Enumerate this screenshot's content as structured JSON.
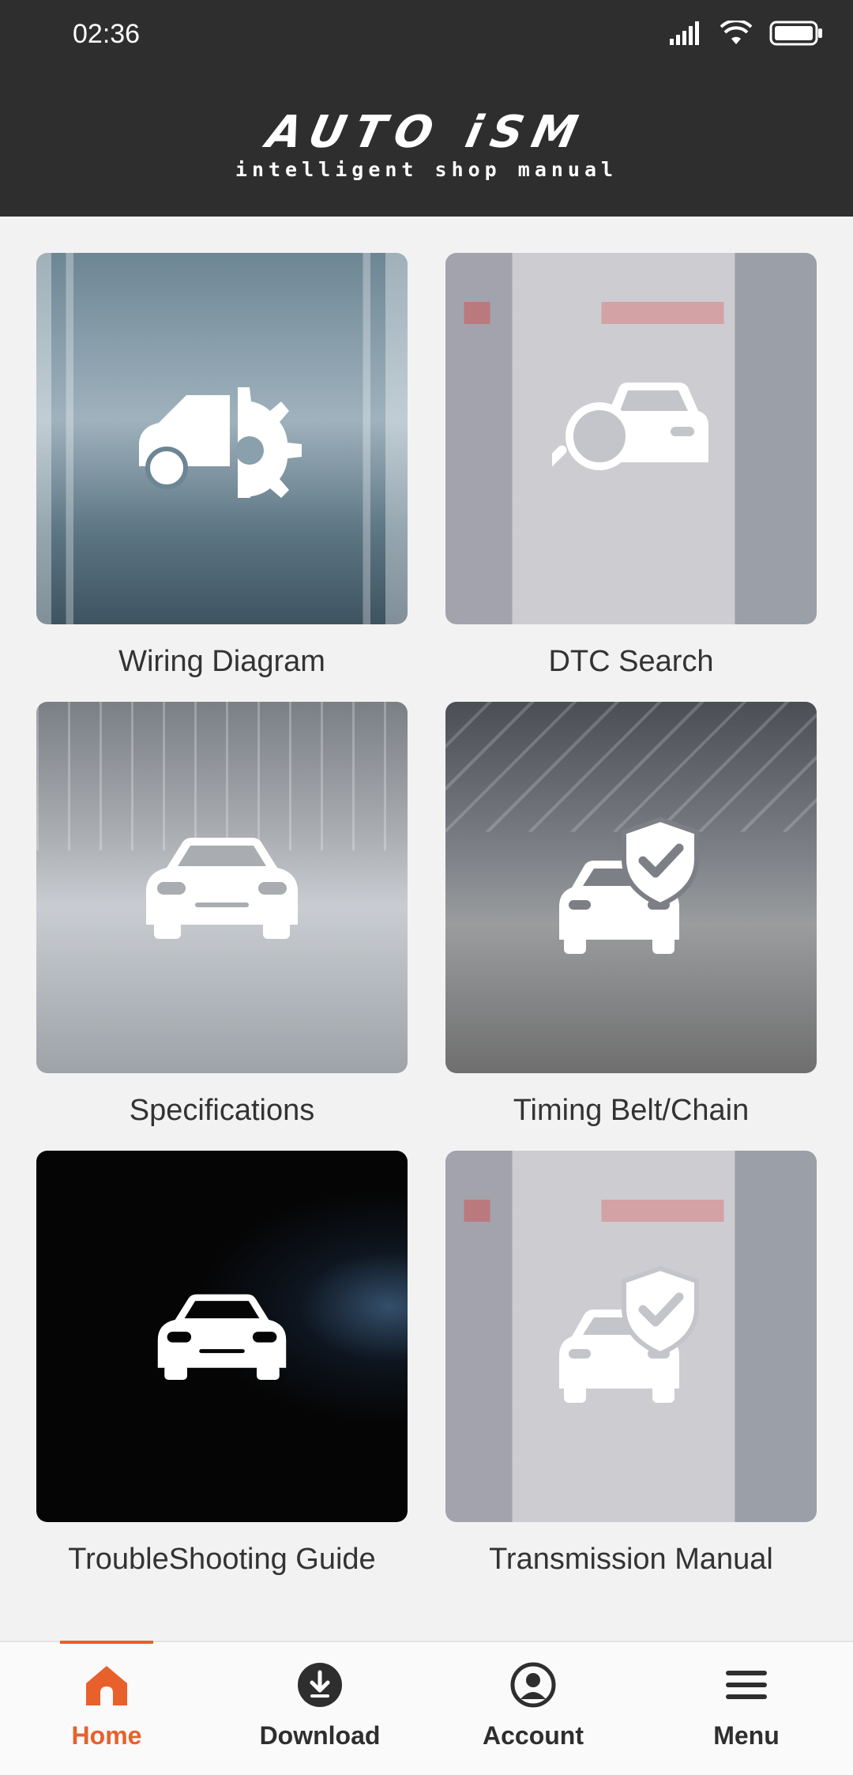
{
  "status_bar": {
    "time": "02:36",
    "icons": [
      "signal-icon",
      "wifi-icon",
      "battery-icon"
    ]
  },
  "header": {
    "logo_main": "AUTO iSM",
    "logo_sub": "intelligent shop manual"
  },
  "tiles": [
    {
      "label": "Wiring Diagram",
      "icon": "car-gear-icon"
    },
    {
      "label": "DTC Search",
      "icon": "car-search-icon"
    },
    {
      "label": "Specifications",
      "icon": "car-front-icon"
    },
    {
      "label": "Timing Belt/Chain",
      "icon": "car-shield-icon"
    },
    {
      "label": "TroubleShooting Guide",
      "icon": "car-front-icon"
    },
    {
      "label": "Transmission Manual",
      "icon": "car-shield-icon"
    }
  ],
  "bottom_nav": {
    "items": [
      {
        "label": "Home",
        "icon": "home-icon",
        "active": true
      },
      {
        "label": "Download",
        "icon": "download-icon",
        "active": false
      },
      {
        "label": "Account",
        "icon": "account-icon",
        "active": false
      },
      {
        "label": "Menu",
        "icon": "menu-icon",
        "active": false
      }
    ]
  },
  "colors": {
    "header_bg": "#2e2e2e",
    "accent": "#e8602c",
    "page_bg": "#f2f2f2"
  }
}
